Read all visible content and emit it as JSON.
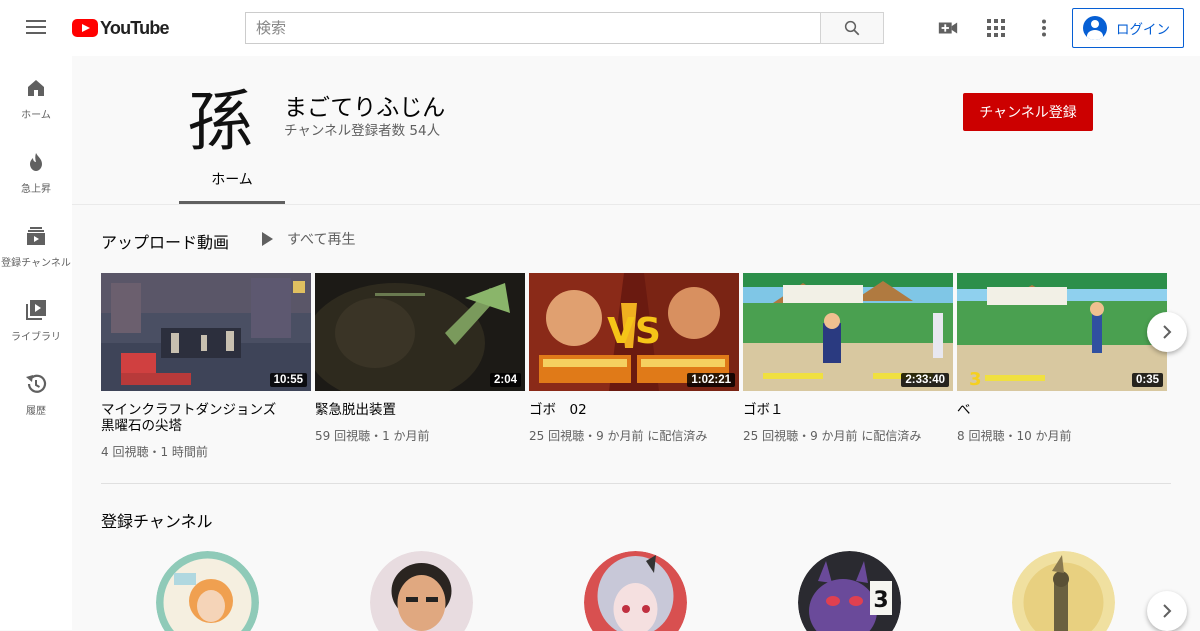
{
  "header": {
    "logo_text": "YouTube",
    "search_placeholder": "検索",
    "login_label": "ログイン",
    "icons": [
      "menu-icon",
      "search-icon",
      "video-camera-add-icon",
      "apps-grid-icon",
      "more-vert-icon",
      "account-circle-icon"
    ]
  },
  "sidebar": {
    "items": [
      {
        "label": "ホーム",
        "icon": "home-icon"
      },
      {
        "label": "急上昇",
        "icon": "trending-flame-icon"
      },
      {
        "label": "登録チャンネル",
        "icon": "subscriptions-icon"
      },
      {
        "label": "ライブラリ",
        "icon": "library-icon"
      },
      {
        "label": "履歴",
        "icon": "history-icon"
      }
    ]
  },
  "channel": {
    "avatar_char": "孫",
    "name": "まごてりふじん",
    "subscribers": "チャンネル登録者数 54人",
    "subscribe_label": "チャンネル登録",
    "tabs": [
      {
        "label": "ホーム",
        "selected": true
      }
    ]
  },
  "uploads": {
    "title": "アップロード動画",
    "play_all": "すべて再生",
    "videos": [
      {
        "title": "マインクラフトダンジョンズ　黒曜石の尖塔",
        "duration": "10:55",
        "meta": "4 回視聴・1 時間前"
      },
      {
        "title": "緊急脱出装置",
        "duration": "2:04",
        "meta": "59 回視聴・1 か月前"
      },
      {
        "title": "ゴボ　02",
        "duration": "1:02:21",
        "meta": "25 回視聴・9 か月前 に配信済み"
      },
      {
        "title": "ゴボ１",
        "duration": "2:33:40",
        "meta": "25 回視聴・9 か月前 に配信済み"
      },
      {
        "title": "べ",
        "duration": "0:35",
        "meta": "8 回視聴・10 か月前"
      }
    ]
  },
  "subscribed_channels": {
    "title": "登録チャンネル",
    "count_visible": 5
  },
  "colors": {
    "brand_red": "#ff0000",
    "subscribe_red": "#cc0000",
    "link_blue": "#065fd4",
    "secondary_text": "#606060"
  }
}
